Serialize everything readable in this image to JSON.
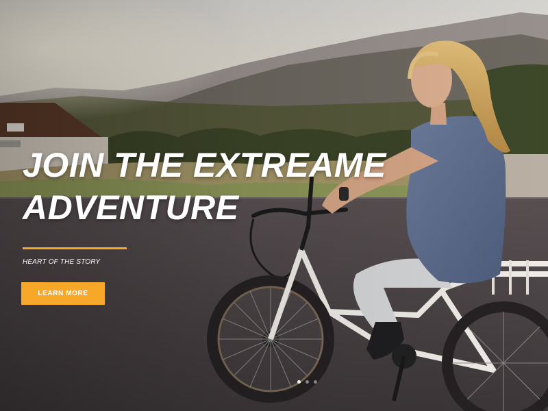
{
  "hero": {
    "title_line1": "JOIN THE EXTREAME",
    "title_line2": "ADVENTURE",
    "subtitle": "HEART OF THE STORY",
    "button_label": "LEARN MORE",
    "accent_color": "#f7a829",
    "text_color": "#ffffff"
  },
  "slider": {
    "slide_count": 3,
    "active_index": 0
  }
}
